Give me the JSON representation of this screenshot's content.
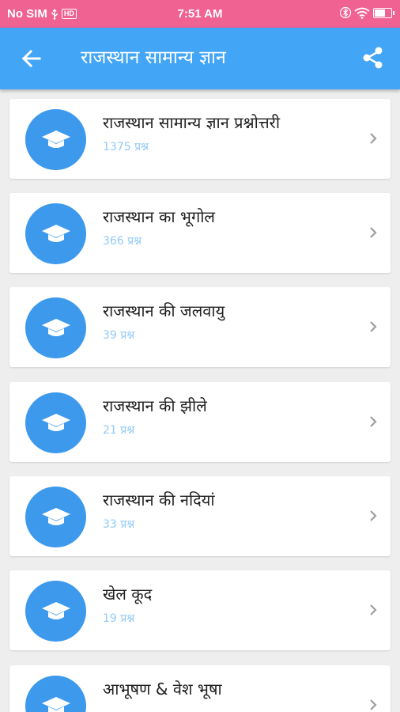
{
  "status_bar": {
    "carrier": "No SIM",
    "hd": "HD",
    "time": "7:51 AM"
  },
  "app_bar": {
    "title": "राजस्थान सामान्य ज्ञान",
    "back_icon": "arrow-back-icon",
    "share_icon": "share-icon"
  },
  "topics": [
    {
      "title": "राजस्थान सामान्य ज्ञान प्रश्नोत्तरी",
      "count": "1375 प्रश्न"
    },
    {
      "title": "राजस्थान का भूगोल",
      "count": "366 प्रश्न"
    },
    {
      "title": "राजस्थान की जलवायु",
      "count": "39 प्रश्न"
    },
    {
      "title": "राजस्थान की झीले",
      "count": "21 प्रश्न"
    },
    {
      "title": "राजस्थान की नदियां",
      "count": "33 प्रश्न"
    },
    {
      "title": "खेल कूद",
      "count": "19 प्रश्न"
    },
    {
      "title": "आभूषण & वेश भूषा",
      "count": ""
    }
  ],
  "colors": {
    "status_bar": "#f06292",
    "app_bar": "#42a5f5",
    "avatar": "#3d99ec",
    "count_text": "#90caf9"
  },
  "icons": {
    "topic_icon": "graduation-cap-icon",
    "row_arrow": "chevron-right-icon"
  }
}
